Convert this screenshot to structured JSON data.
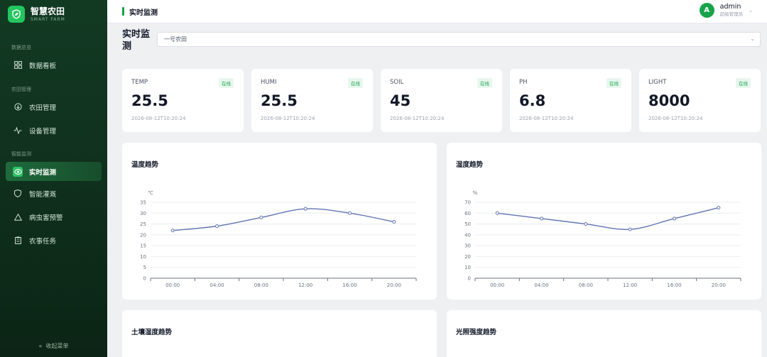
{
  "brand": {
    "title": "智慧农田",
    "subtitle": "SMART FARM"
  },
  "sidebar": {
    "sections": [
      "数据总览",
      "农田管理",
      "智能监测"
    ],
    "items": [
      {
        "label": "数据看板",
        "icon": "grid-icon"
      },
      {
        "label": "农田管理",
        "icon": "field-icon"
      },
      {
        "label": "设备管理",
        "icon": "pulse-icon"
      },
      {
        "label": "实时监测",
        "icon": "eye-icon",
        "active": true
      },
      {
        "label": "智能灌溉",
        "icon": "shield-icon"
      },
      {
        "label": "病虫害预警",
        "icon": "warning-icon"
      },
      {
        "label": "农事任务",
        "icon": "clipboard-icon"
      }
    ],
    "collapse_label": "收起菜单"
  },
  "topbar": {
    "breadcrumb": "实时监测",
    "user": {
      "avatar_letter": "A",
      "name": "admin",
      "role": "超级管理员"
    }
  },
  "page": {
    "title": "实时监测",
    "farm_select": {
      "value": "一号农田"
    }
  },
  "metrics": [
    {
      "label": "TEMP",
      "status": "在线",
      "value": "25.5",
      "time": "2026-08-12T10:20:24"
    },
    {
      "label": "HUMI",
      "status": "在线",
      "value": "25.5",
      "time": "2026-08-12T10:20:24"
    },
    {
      "label": "SOIL",
      "status": "在线",
      "value": "45",
      "time": "2026-08-12T10:20:24"
    },
    {
      "label": "PH",
      "status": "在线",
      "value": "6.8",
      "time": "2026-08-12T10:20:24"
    },
    {
      "label": "LIGHT",
      "status": "在线",
      "value": "8000",
      "time": "2026-08-12T10:20:24"
    }
  ],
  "chart_data": [
    {
      "type": "line",
      "title": "温度趋势",
      "ylabel": "℃",
      "x": [
        "00:00",
        "04:00",
        "08:00",
        "12:00",
        "16:00",
        "20:00"
      ],
      "values": [
        22,
        24,
        28,
        32,
        30,
        26
      ],
      "ylim": [
        0,
        35
      ],
      "yticks": [
        0,
        5,
        10,
        15,
        20,
        25,
        30,
        35
      ],
      "color": "#6275b3"
    },
    {
      "type": "line",
      "title": "湿度趋势",
      "ylabel": "%",
      "x": [
        "00:00",
        "04:00",
        "08:00",
        "12:00",
        "16:00",
        "20:00"
      ],
      "values": [
        60,
        55,
        50,
        45,
        55,
        65
      ],
      "ylim": [
        0,
        70
      ],
      "yticks": [
        0,
        10,
        20,
        30,
        40,
        50,
        60,
        70
      ],
      "color": "#6275b3"
    }
  ],
  "bottom_charts": [
    {
      "title": "土壤湿度趋势"
    },
    {
      "title": "光照强度趋势"
    }
  ],
  "colors": {
    "accent": "#16a34a",
    "sidebar_bg": "#123a23",
    "line": "#6275b3"
  }
}
